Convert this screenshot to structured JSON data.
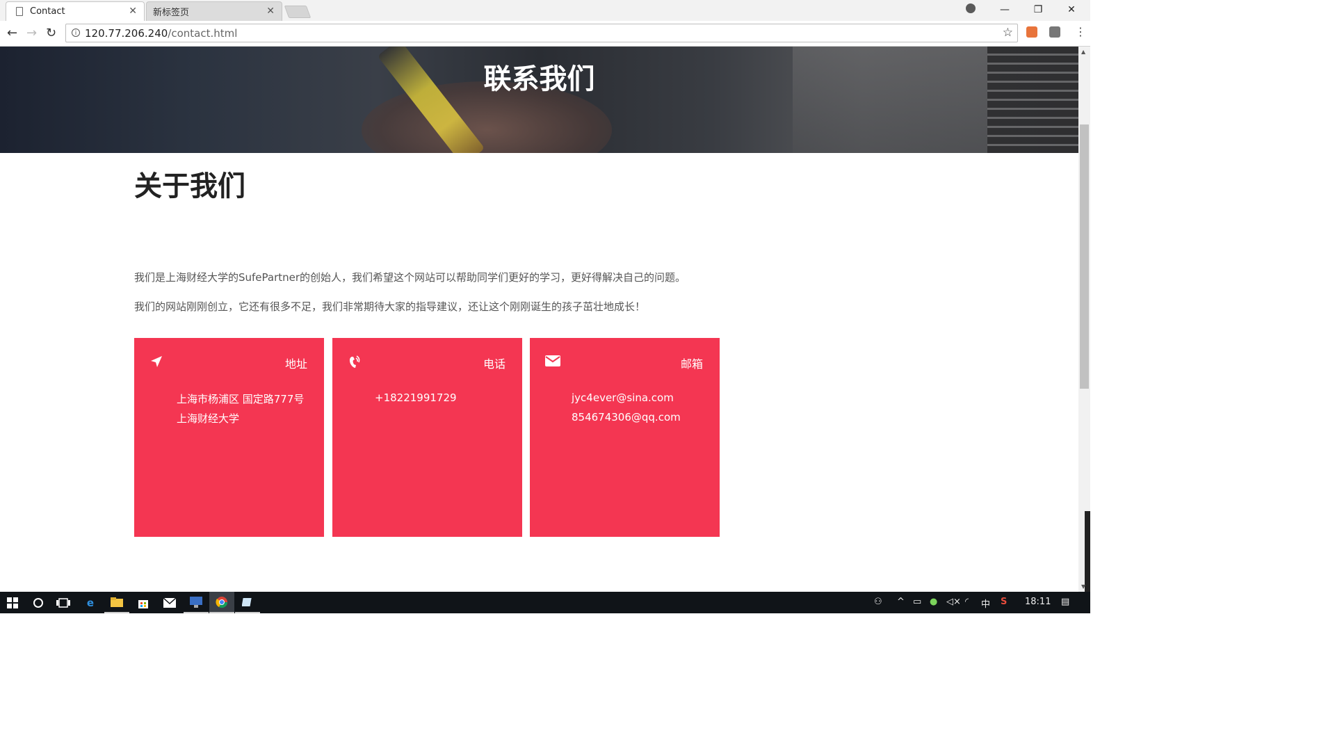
{
  "browser": {
    "tabs": [
      {
        "label": "Contact",
        "active": true
      },
      {
        "label": "新标签页",
        "active": false
      }
    ],
    "url_host": "120.77.206.240",
    "url_path": "/contact.html"
  },
  "page": {
    "hero_title": "联系我们",
    "section_title": "关于我们",
    "paragraphs": [
      "我们是上海财经大学的SufePartner的创始人，我们希望这个网站可以帮助同学们更好的学习，更好得解决自己的问题。",
      "我们的网站刚刚创立，它还有很多不足，我们非常期待大家的指导建议，还让这个刚刚诞生的孩子茁壮地成长！"
    ],
    "cards": [
      {
        "icon": "location-arrow-icon",
        "title": "地址",
        "lines": [
          "上海市杨浦区 国定路777号",
          "上海财经大学"
        ]
      },
      {
        "icon": "phone-icon",
        "title": "电话",
        "lines": [
          "+18221991729"
        ]
      },
      {
        "icon": "envelope-icon",
        "title": "邮箱",
        "lines": [
          "jyc4ever@sina.com",
          "854674306@qq.com"
        ]
      }
    ],
    "card_color": "#f43652"
  },
  "taskbar": {
    "ime": "中",
    "clock": "18:11"
  }
}
